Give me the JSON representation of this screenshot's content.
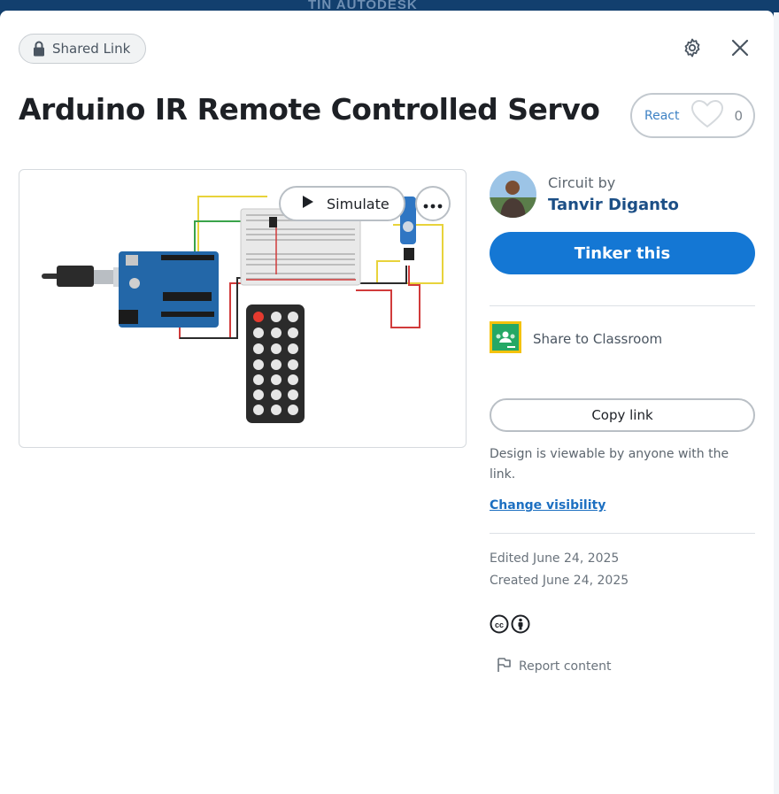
{
  "background": {
    "brand_text": "TIN AUTODESK"
  },
  "header": {
    "shared_link_label": "Shared Link",
    "settings_icon": "gear-icon",
    "close_icon": "close-icon"
  },
  "design": {
    "title": "Arduino IR Remote Controlled Servo",
    "react_label": "React",
    "react_count": "0"
  },
  "preview": {
    "simulate_label": "Simulate",
    "more_icon": "more-options-icon"
  },
  "author": {
    "circuit_by_label": "Circuit by",
    "name": "Tanvir Diganto"
  },
  "actions": {
    "tinker_label": "Tinker this",
    "share_classroom_label": "Share to Classroom",
    "copy_link_label": "Copy link",
    "visibility_note": "Design is viewable by anyone with the link.",
    "change_visibility_label": "Change visibility"
  },
  "meta": {
    "edited": "Edited June 24, 2025",
    "created": "Created June 24, 2025",
    "license_icons": [
      "cc-icon",
      "attribution-icon"
    ],
    "report_label": "Report content"
  },
  "colors": {
    "primary": "#1477d4",
    "link": "#1c6fc1",
    "author": "#1c4f86",
    "backdrop": "#0f3b66"
  }
}
